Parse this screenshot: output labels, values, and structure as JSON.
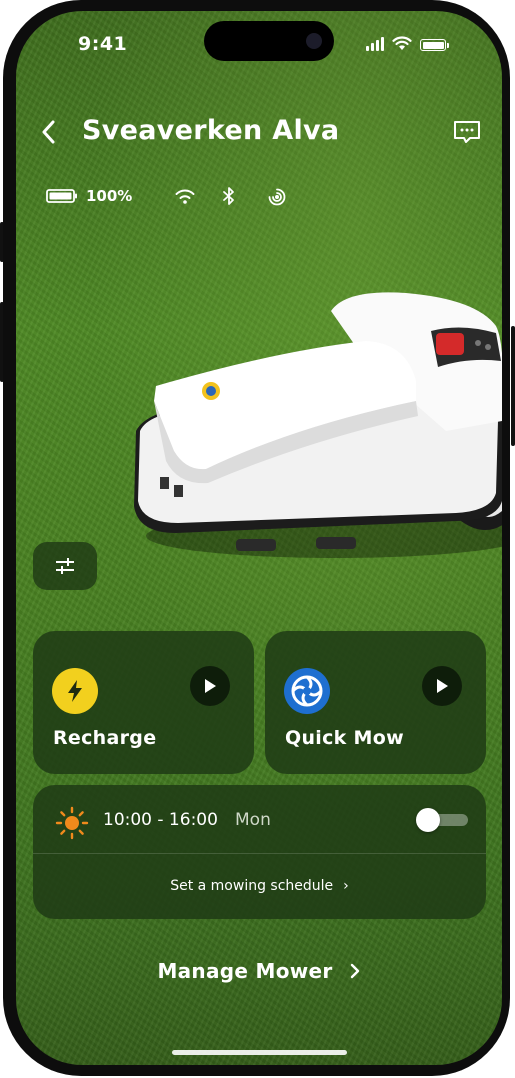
{
  "status_bar": {
    "time": "9:41",
    "icons": [
      "cellular-signal-icon",
      "wifi-icon",
      "battery-icon"
    ]
  },
  "header": {
    "title": "Sveaverken Alva",
    "back_icon": "chevron-left-icon",
    "message_icon": "chat-bubble-icon"
  },
  "device_status": {
    "battery_percent": "100%",
    "icons": [
      "battery-icon",
      "wifi-icon",
      "bluetooth-icon",
      "gps-signal-icon"
    ]
  },
  "actions": [
    {
      "label": "Recharge",
      "icon": "lightning-icon",
      "icon_color": "#f2d01e"
    },
    {
      "label": "Quick Mow",
      "icon": "fan-blade-icon",
      "icon_color": "#1e6fd0"
    }
  ],
  "schedule": {
    "time_range": "10:00 - 16:00",
    "day": "Mon",
    "enabled": false,
    "link_label": "Set a mowing schedule",
    "sun_color": "#f08a1c"
  },
  "manage_label": "Manage Mower",
  "colors": {
    "card_bg": "#203c16",
    "grass": "#4a8222",
    "accent_yellow": "#f2d01e",
    "accent_blue": "#1e6fd0"
  }
}
